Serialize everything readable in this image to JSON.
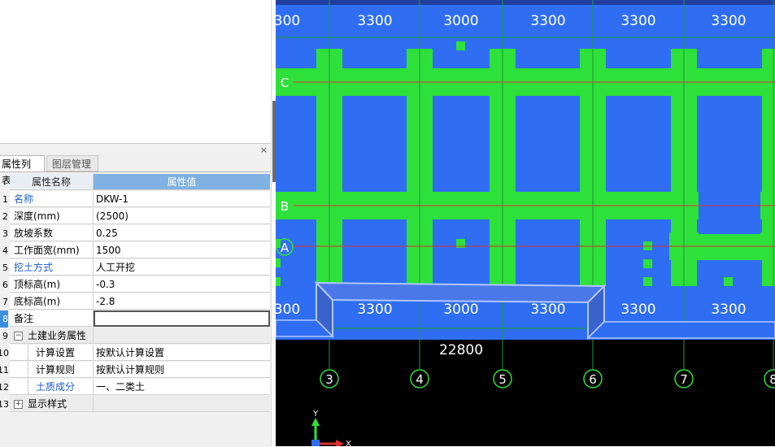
{
  "panel": {
    "close_label": "×",
    "tabs": [
      "属性列表",
      "图层管理"
    ],
    "header": {
      "name": "属性名称",
      "value": "属性值"
    },
    "rows": [
      {
        "num": "1",
        "name": "名称",
        "value": "DKW-1"
      },
      {
        "num": "2",
        "name": "深度(mm)",
        "value": "(2500)"
      },
      {
        "num": "3",
        "name": "放坡系数",
        "value": "0.25"
      },
      {
        "num": "4",
        "name": "工作面宽(mm)",
        "value": "1500"
      },
      {
        "num": "5",
        "name": "挖土方式",
        "value": "人工开挖"
      },
      {
        "num": "6",
        "name": "顶标高(m)",
        "value": "-0.3"
      },
      {
        "num": "7",
        "name": "底标高(m)",
        "value": "-2.8"
      },
      {
        "num": "8",
        "name": "备注",
        "value": ""
      },
      {
        "num": "9",
        "name": "土建业务属性",
        "value": "",
        "toggle": "−"
      },
      {
        "num": "10",
        "name": "计算设置",
        "value": "按默认计算设置"
      },
      {
        "num": "11",
        "name": "计算规则",
        "value": "按默认计算规则"
      },
      {
        "num": "12",
        "name": "土质成分",
        "value": "一、二类土"
      },
      {
        "num": "13",
        "name": "显示样式",
        "value": "",
        "toggle": "+"
      }
    ]
  },
  "cad": {
    "colors": {
      "background": "#000000",
      "slab": "#2f6ef2",
      "beam": "#2ee03a",
      "axis_line": "#e03030",
      "grid_line": "#1f9a3a",
      "highlight": "#7da4ff",
      "axis_bubble": "#2ee03a"
    },
    "top_dims": [
      "300",
      "3300",
      "3000",
      "3300",
      "3300",
      "3300"
    ],
    "lower_dims": [
      "300",
      "3300",
      "3000",
      "3300",
      "3300",
      "3300"
    ],
    "total_dim": "22800",
    "row_axes": [
      "C",
      "B",
      "A"
    ],
    "col_axes": [
      "3",
      "4",
      "5",
      "6",
      "7",
      "8"
    ],
    "ucs": {
      "y": "Y",
      "x": "X"
    }
  }
}
